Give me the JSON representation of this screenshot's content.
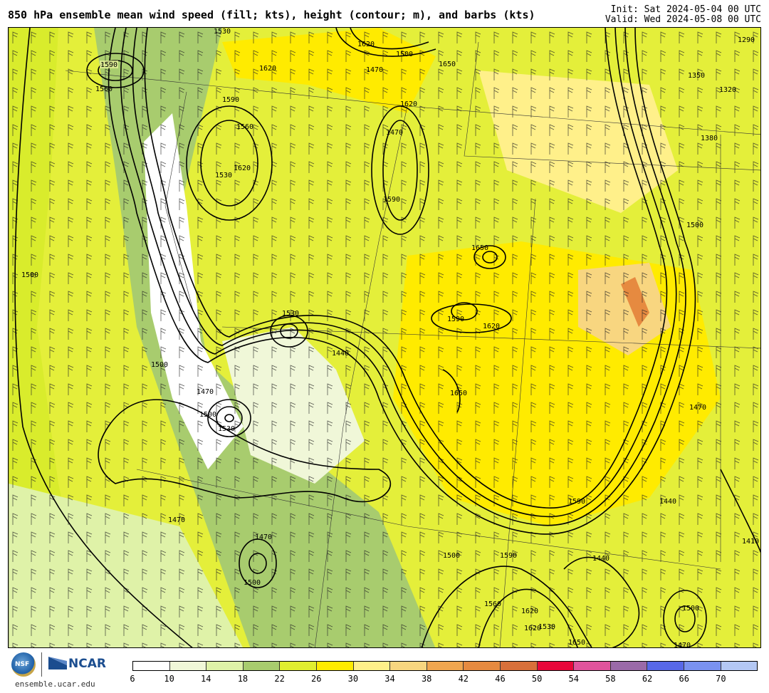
{
  "header": {
    "title": "850 hPa ensemble mean wind speed (fill; kts), height (contour; m), and barbs (kts)",
    "init": "Init: Sat 2024-05-04 00 UTC",
    "valid": "Valid: Wed 2024-05-08 00 UTC"
  },
  "map": {
    "fill_variable": "850 hPa ensemble mean wind speed",
    "contour_variable": "850 hPa height",
    "contour_labels": [
      {
        "text": "1590"
      },
      {
        "text": "1560"
      },
      {
        "text": "1590"
      },
      {
        "text": "1530"
      },
      {
        "text": "1620"
      },
      {
        "text": "1500"
      },
      {
        "text": "1470"
      },
      {
        "text": "1650"
      },
      {
        "text": "1620"
      },
      {
        "text": "1560"
      },
      {
        "text": "1530"
      },
      {
        "text": "1620"
      },
      {
        "text": "1470"
      },
      {
        "text": "1590"
      },
      {
        "text": "1500"
      },
      {
        "text": "1620"
      },
      {
        "text": "1650"
      },
      {
        "text": "1590"
      },
      {
        "text": "1620"
      },
      {
        "text": "1530"
      },
      {
        "text": "1440"
      },
      {
        "text": "1500"
      },
      {
        "text": "1470"
      },
      {
        "text": "1500"
      },
      {
        "text": "1530"
      },
      {
        "text": "1650"
      },
      {
        "text": "1500"
      },
      {
        "text": "1470"
      },
      {
        "text": "1470"
      },
      {
        "text": "1500"
      },
      {
        "text": "1590"
      },
      {
        "text": "1620"
      },
      {
        "text": "1590"
      },
      {
        "text": "1500"
      },
      {
        "text": "1440"
      },
      {
        "text": "1410"
      },
      {
        "text": "1350"
      },
      {
        "text": "1320"
      },
      {
        "text": "1380"
      },
      {
        "text": "1290"
      },
      {
        "text": "1440"
      },
      {
        "text": "1500"
      },
      {
        "text": "1470"
      },
      {
        "text": "1560"
      },
      {
        "text": "1620"
      },
      {
        "text": "1530"
      },
      {
        "text": "1650"
      },
      {
        "text": "1470"
      }
    ]
  },
  "colorbar": {
    "ticks": [
      "6",
      "10",
      "14",
      "18",
      "22",
      "26",
      "30",
      "34",
      "38",
      "42",
      "46",
      "50",
      "54",
      "58",
      "62",
      "66",
      "70"
    ],
    "colors": [
      "#ffffff",
      "#f0f7d8",
      "#dff2a8",
      "#a8cc6e",
      "#e0ee30",
      "#ffeb00",
      "#fff08a",
      "#f8d680",
      "#f0a650",
      "#e68a40",
      "#d8703a",
      "#e8073a",
      "#e0549c",
      "#9a6aa8",
      "#5868e8",
      "#7a92f0",
      "#b4c8f4"
    ]
  },
  "branding": {
    "nsf_label": "NSF",
    "org": "NCAR",
    "url": "ensemble.ucar.edu"
  }
}
